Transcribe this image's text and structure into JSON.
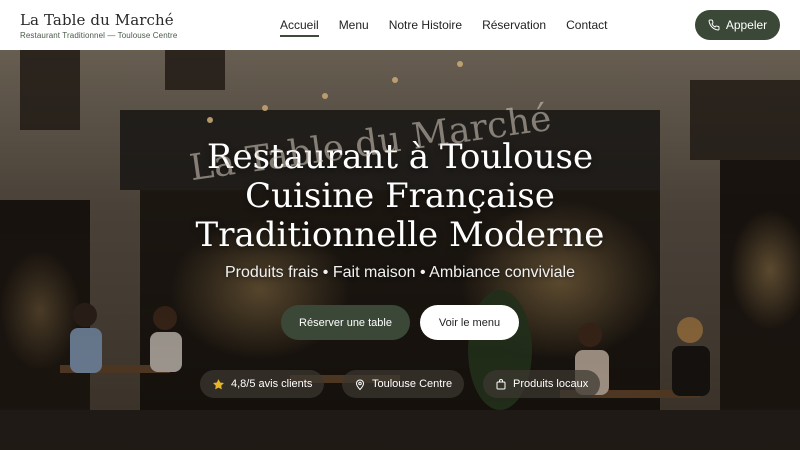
{
  "header": {
    "brand_name": "La Table du Marché",
    "brand_sub": "Restaurant Traditionnel — Toulouse Centre",
    "nav": [
      {
        "label": "Accueil",
        "active": true
      },
      {
        "label": "Menu",
        "active": false
      },
      {
        "label": "Notre Histoire",
        "active": false
      },
      {
        "label": "Réservation",
        "active": false
      },
      {
        "label": "Contact",
        "active": false
      }
    ],
    "call_label": "Appeler",
    "call_icon": "phone-icon"
  },
  "hero": {
    "sign_text": "La Table du Marché",
    "title_lines": [
      "Restaurant à Toulouse",
      "Cuisine Française",
      "Traditionnelle Moderne"
    ],
    "subtitle": "Produits frais • Fait maison • Ambiance conviviale",
    "primary_button": "Réserver une table",
    "secondary_button": "Voir le menu",
    "badges": [
      {
        "icon": "star-icon",
        "label": "4,8/5 avis clients"
      },
      {
        "icon": "location-pin-icon",
        "label": "Toulouse Centre"
      },
      {
        "icon": "shopping-bag-icon",
        "label": "Produits locaux"
      }
    ]
  },
  "colors": {
    "accent": "#3b4838",
    "star": "#e7b52b",
    "header_bg": "#ffffff"
  }
}
